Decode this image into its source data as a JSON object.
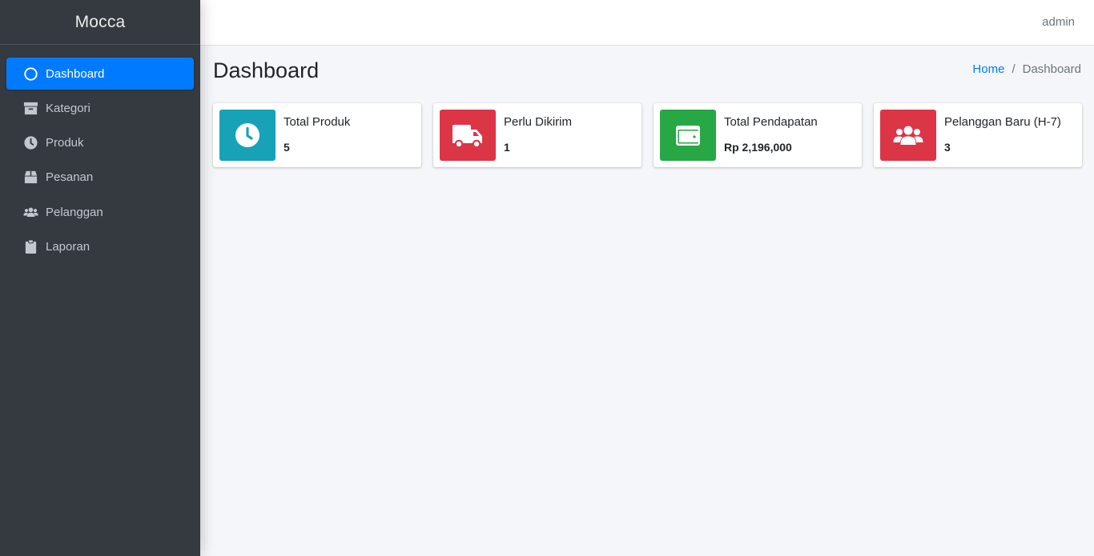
{
  "brand": {
    "name": "Mocca"
  },
  "sidebar": {
    "items": [
      {
        "label": "Dashboard",
        "icon": "circle-icon",
        "active": true
      },
      {
        "label": "Kategori",
        "icon": "archive-icon",
        "active": false
      },
      {
        "label": "Produk",
        "icon": "clock-icon",
        "active": false
      },
      {
        "label": "Pesanan",
        "icon": "box-icon",
        "active": false
      },
      {
        "label": "Pelanggan",
        "icon": "users-icon",
        "active": false
      },
      {
        "label": "Laporan",
        "icon": "clipboard-icon",
        "active": false
      }
    ]
  },
  "header": {
    "user": "admin"
  },
  "page": {
    "title": "Dashboard",
    "breadcrumb": {
      "home": "Home",
      "separator": "/",
      "current": "Dashboard"
    }
  },
  "cards": [
    {
      "label": "Total Produk",
      "value": "5",
      "icon": "clock-icon",
      "color": "#17a2b8"
    },
    {
      "label": "Perlu Dikirim",
      "value": "1",
      "icon": "truck-icon",
      "color": "#dc3545"
    },
    {
      "label": "Total Pendapatan",
      "value": "Rp 2,196,000",
      "icon": "wallet-icon",
      "color": "#28a745"
    },
    {
      "label": "Pelanggan Baru (H-7)",
      "value": "3",
      "icon": "users-icon",
      "color": "#dc3545"
    }
  ],
  "colors": {
    "sidebar_bg": "#343a40",
    "active": "#007bff",
    "page_bg": "#f4f6f9"
  }
}
